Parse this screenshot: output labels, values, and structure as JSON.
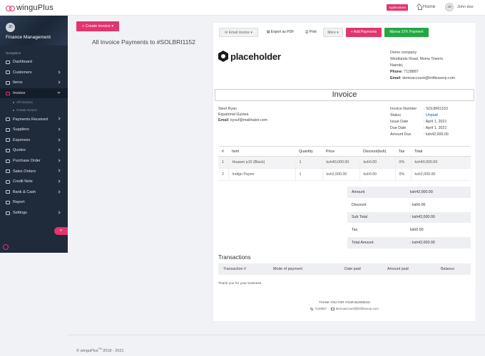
{
  "topbar": {
    "logo_text": "winguPlus",
    "apps_label": "Applications",
    "home_label": "Home",
    "user_initials": "JD",
    "user_name": "John doe"
  },
  "sidebar": {
    "profile_initials": "JD",
    "profile_title": "Finance Management",
    "nav_heading": "Navigation",
    "items": [
      {
        "label": "Dashboard",
        "chevron": false
      },
      {
        "label": "Customers",
        "chevron": true
      },
      {
        "label": "Items",
        "chevron": true
      },
      {
        "label": "Invoice",
        "chevron": true,
        "active": true
      },
      {
        "label": "Payments Received",
        "chevron": true
      },
      {
        "label": "Suppliers",
        "chevron": true
      },
      {
        "label": "Expenses",
        "chevron": true
      },
      {
        "label": "Quotes",
        "chevron": true
      },
      {
        "label": "Purchase Order",
        "chevron": true
      },
      {
        "label": "Sales Orders",
        "chevron": true
      },
      {
        "label": "Credit Note",
        "chevron": true
      },
      {
        "label": "Bank & Cash",
        "chevron": true
      },
      {
        "label": "Report",
        "chevron": false
      },
      {
        "label": "Settings",
        "chevron": true
      }
    ],
    "sub_items": [
      "All Invoices",
      "Create Invoice"
    ],
    "collapse_label": "«"
  },
  "left": {
    "create_label": "+ Create invoice ▾",
    "heading": "All Invoice Payments to #SOLBRI1152"
  },
  "toolbar": {
    "email": "✉ Email invoice ▾",
    "pdf": "▤ Export as PDF",
    "print": "⎙ Print",
    "more": "More ▾",
    "add_payments": "+ Add Payments",
    "mpesa": "Mpesa STK Payment"
  },
  "brand": {
    "text": "placeholder"
  },
  "company": {
    "name": "Demo company",
    "address1": "Westlands Road, Mvina Towers",
    "address2": "Nairobi,",
    "phone_label": "Phone",
    "phone": ": 7128887",
    "email_label": "Email",
    "email": ": demoaccount@lmfilesserp.com"
  },
  "invoice": {
    "title": "Invoice",
    "bill_name": "Steel Ryan",
    "bill_country": "Equatorial Guinea",
    "bill_email_label": "Email",
    "bill_email": ": kysuf@mailinator.com",
    "meta": [
      {
        "label": "Invoice Number",
        "value": ": SOLBRI1153"
      },
      {
        "label": "Status",
        "value": ": Unpaid"
      },
      {
        "label": "Issue Date",
        "value": ": April 1, 2021"
      },
      {
        "label": "Due Date",
        "value": ": April 1, 2021"
      },
      {
        "label": "Amount Due",
        "value": ": ksh42,000.00"
      }
    ]
  },
  "items_table": {
    "headers": [
      "#",
      "Item",
      "Quantity",
      "Price",
      "Discount(ksh)",
      "Tax",
      "Total"
    ],
    "rows": [
      [
        "1",
        "Huawei p10 (Black)",
        "1",
        "ksh40,000.00",
        "ksh0.00",
        "0%",
        "ksh40,000.00"
      ],
      [
        "2",
        "Indigo Payne",
        "1",
        "ksh2,000.00",
        "ksh0.00",
        "0%",
        "ksh2,000.00"
      ]
    ]
  },
  "totals": [
    {
      "label": "Amount",
      "value": "ksh42,000.00"
    },
    {
      "label": "Discount",
      "value": ": ksh0.00"
    },
    {
      "label": "Sub Total",
      "value": ": ksh42,000.00"
    },
    {
      "label": "Tax",
      "value": "ksh0.00"
    },
    {
      "label": "Total Amount",
      "value": ": ksh42,000.00"
    }
  ],
  "transactions": {
    "title": "Transactions",
    "headers": [
      "Transaction #",
      "Mode of payment",
      "Date paid",
      "Amount paid",
      "Balance"
    ]
  },
  "footer": {
    "thanks": "Thank you for your business.",
    "heading": "THANK YOU FOR YOUR BUSINESS",
    "phone": "7128887",
    "email": "demoaccount@lmfilesserp.com",
    "copyright_brand": "© winguPlus",
    "copyright_mark": "TM",
    "copyright_years": " 2018 - 2021"
  },
  "colors": {
    "accent": "#e2346e",
    "green": "#21a843",
    "sidebar": "#1f2a3b",
    "status_blue": "#1857b8"
  }
}
